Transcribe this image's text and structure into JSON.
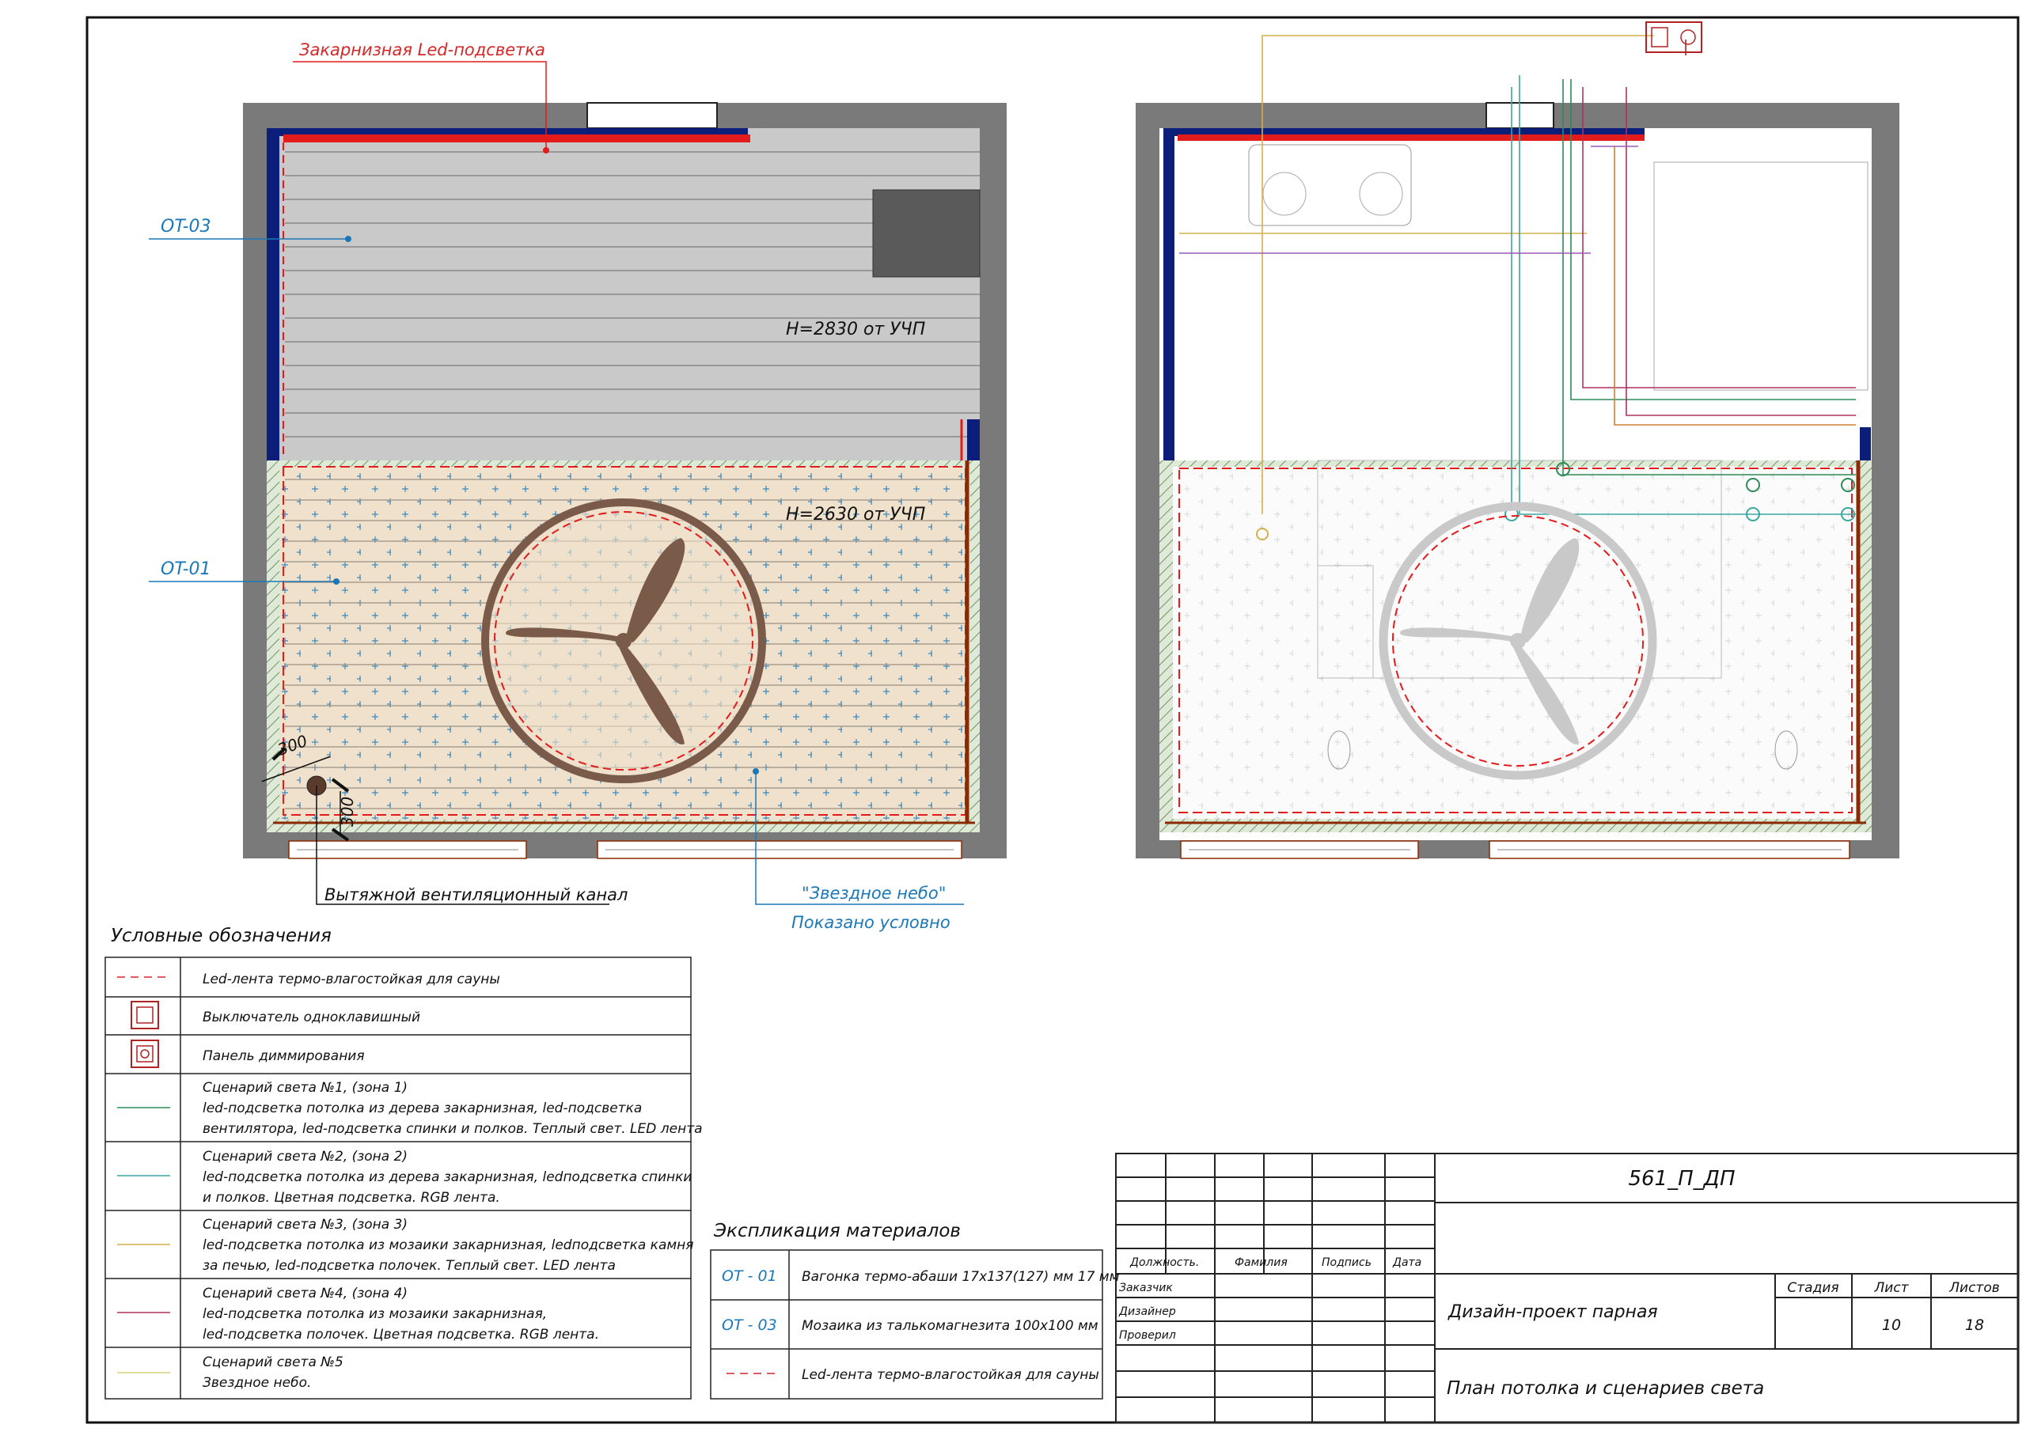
{
  "plan1": {
    "cornice_label": "Закарнизная Led-подсветка",
    "ot03": "OT-03",
    "ot01": "OT-01",
    "h_upper": "H=2830 от УЧП",
    "h_lower": "H=2630 от УЧП",
    "dim_a": "300",
    "dim_b": "300",
    "vent_label": "Вытяжной вентиляционный канал",
    "sky_label": "\"Звездное небо\"",
    "sky_note": "Показано условно"
  },
  "legend": {
    "title": "Условные обозначения",
    "items": [
      {
        "lines": [
          "Led-лента термо-влагостойкая для сауны"
        ]
      },
      {
        "lines": [
          "Выключатель одноклавишный"
        ]
      },
      {
        "lines": [
          "Панель диммирования"
        ]
      },
      {
        "lines": [
          "Сценарий света №1, (зона 1)",
          "led-подсветка потолка из дерева закарнизная, led-подсветка",
          "вентилятора, led-подсветка спинки и полков. Теплый свет. LED лента"
        ]
      },
      {
        "lines": [
          "Сценарий света №2, (зона 2)",
          "led-подсветка потолка из дерева закарнизная, ledподсветка спинки",
          "и полков. Цветная подсветка. RGB лента."
        ]
      },
      {
        "lines": [
          "Сценарий света №3, (зона 3)",
          "led-подсветка потолка из мозаики закарнизная, ledподсветка камня",
          "за печью, led-подсветка полочек. Теплый свет. LED лента"
        ]
      },
      {
        "lines": [
          "Сценарий света №4, (зона 4)",
          "led-подсветка потолка из мозаики закарнизная,",
          "led-подсветка полочек. Цветная подсветка. RGB лента."
        ]
      },
      {
        "lines": [
          "Сценарий света №5",
          "Звездное небо."
        ]
      }
    ],
    "colors": {
      "led": "#d62728",
      "switch": "#b22222",
      "s1": "#2e8b57",
      "s2": "#3aa7a0",
      "s3": "#d4b04a",
      "s4": "#b03060",
      "s5": "#d9d27a"
    }
  },
  "explication": {
    "title": "Экспликация материалов",
    "rows": [
      {
        "code": "OT - 01",
        "text": "Вагонка термо-абаши 17х137(127) мм   17 мм"
      },
      {
        "code": "OT - 03",
        "text": "Мозаика из талькомагнезита 100х100 мм"
      },
      {
        "code": "",
        "text": "Led-лента термо-влагостойкая для сауны"
      }
    ]
  },
  "stamp": {
    "code": "561_П_ДП",
    "col_role": "Должность.",
    "col_name": "Фамилия",
    "col_sign": "Подпись",
    "col_date": "Дата",
    "role1": "Заказчик",
    "role2": "Дизайнер",
    "role3": "Проверил",
    "project": "Дизайн-проект парная",
    "sheet_title": "План потолка и сценариев света",
    "stage_label": "Стадия",
    "sheet_label": "Лист",
    "sheets_label": "Листов",
    "stage": "",
    "sheet": "10",
    "sheets": "18"
  }
}
